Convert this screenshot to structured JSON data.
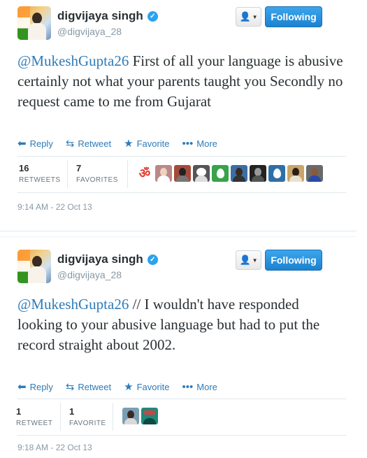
{
  "tweets": [
    {
      "name": "digvijaya singh",
      "handle": "@digvijaya_28",
      "follow_label": "Following",
      "mention": "@MukeshGupta26",
      "body": " First of all your language is abusive certainly not what your parents taught you Secondly no request came to me from Gujarat",
      "actions": {
        "reply": "Reply",
        "retweet": "Retweet",
        "favorite": "Favorite",
        "more": "More"
      },
      "stats": {
        "retweets": "16",
        "retweets_label": "RETWEETS",
        "favorites": "7",
        "favorites_label": "FAVORITES"
      },
      "timestamp": "9:14 AM - 22 Oct 13"
    },
    {
      "name": "digvijaya singh",
      "handle": "@digvijaya_28",
      "follow_label": "Following",
      "mention": "@MukeshGupta26",
      "body": " // I wouldn't have responded looking to your abusive language but had to put the record straight about 2002.",
      "actions": {
        "reply": "Reply",
        "retweet": "Retweet",
        "favorite": "Favorite",
        "more": "More"
      },
      "stats": {
        "retweets": "1",
        "retweets_label": "RETWEET",
        "favorites": "1",
        "favorites_label": "FAVORITE"
      },
      "timestamp": "9:18 AM - 22 Oct 13"
    }
  ],
  "icons": {
    "verified": "verified-check-icon",
    "user_dropdown": "user-icon",
    "reply": "reply-arrow-icon",
    "retweet": "retweet-icon",
    "favorite": "star-icon",
    "more": "ellipsis-icon"
  },
  "colors": {
    "link": "#2e7bb8",
    "follow_button": "#1b82d1",
    "verified": "#2aa3ef",
    "muted": "#8899a6"
  }
}
